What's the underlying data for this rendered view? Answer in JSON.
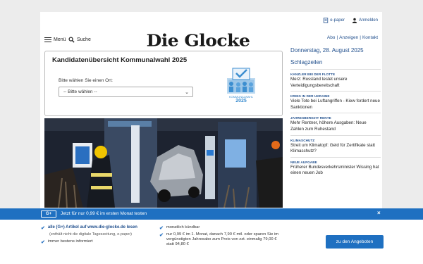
{
  "top": {
    "epaper": "e-paper",
    "login": "Anmelden"
  },
  "header": {
    "menu_label": "Menü",
    "search_label": "Suche",
    "logo": "Die Glocke",
    "links": [
      "Abo",
      "Anzeigen",
      "Kontakt"
    ]
  },
  "widget": {
    "title": "Kandidatenübersicht Kommunalwahl 2025",
    "select_label": "Bitte wählen Sie einen Ort:",
    "select_value": "-- Bitte wählen --",
    "emblem_line": "KOMMUNALWAHL",
    "emblem_year": "2025"
  },
  "sidebar": {
    "date": "Donnerstag, 28. August 2025",
    "section": "Schlagzeilen",
    "items": [
      {
        "kicker": "KANZLER BEI DER FLOTTE",
        "headline": "Merz: Russland testet unsere Verteidigungsbereitschaft"
      },
      {
        "kicker": "KRIEG IN DER UKRAINE",
        "headline": "Viele Tote bei Luftangriffen - Kiew fordert neue Sanktionen"
      },
      {
        "kicker": "JAHRESBERICHT RENTE",
        "headline": "Mehr Rentner, höhere Ausgaben: Neue Zahlen zum Ruhestand"
      },
      {
        "kicker": "KLIMASCHUTZ",
        "headline": "Streit um Klimatopf: Geld für Zertifikate statt Klimaschutz?"
      },
      {
        "kicker": "NEUE AUFGABE",
        "headline": "Früherer Bundesverkehrsminister Wissing hat einen neuen Job"
      }
    ]
  },
  "promo": {
    "badge": "G+",
    "text": "Jetzt für nur 0,99 € im ersten Monat testen",
    "close": "×"
  },
  "offer": {
    "col1": [
      {
        "text": "alle (G+) Artikel auf www.die-glocke.de lesen",
        "sub": "(enthält nicht die digitale Tageszeitung, e-paper)"
      },
      {
        "text": "immer bestens informiert",
        "sub": ""
      }
    ],
    "col2": [
      {
        "text": "monatlich kündbar"
      },
      {
        "text": "nur 0,99 € im 1. Monat, danach 7,90 € mtl. oder sparen Sie im vergünstigten Jahresabo zum Preis von zzt. einmalig 79,00 € statt 94,80 €"
      }
    ],
    "cta": "zu den Angeboten",
    "check": "✔"
  },
  "colors": {
    "brand_blue": "#1f70c1",
    "link_blue": "#1f4e8c"
  }
}
